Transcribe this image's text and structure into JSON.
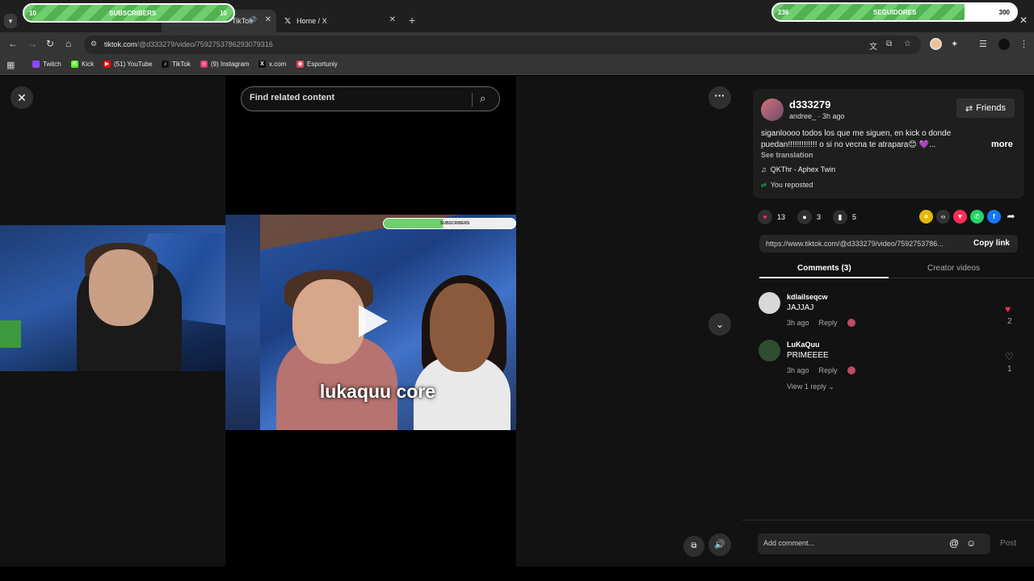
{
  "browser": {
    "tabs": [
      {
        "label": "TikTok",
        "active": true
      },
      {
        "label": "Home / X",
        "active": false
      }
    ],
    "url_host": "tiktok.com",
    "url_path": "/@d333279/video/7592753786293079316",
    "bookmarks": [
      {
        "label": "Twitch",
        "color": "#9146ff"
      },
      {
        "label": "Kick",
        "color": "#53fc18"
      },
      {
        "label": "(51) YouTube",
        "color": "#ff0000"
      },
      {
        "label": "TikTok",
        "color": "#111111"
      },
      {
        "label": "(9) Instagram",
        "color": "#e1306c"
      },
      {
        "label": "x.com",
        "color": "#111111"
      },
      {
        "label": "Esportuniy",
        "color": "#e0405a"
      }
    ]
  },
  "overlays": {
    "subscribers": {
      "left": "10",
      "label": "SUBSCRIBERS",
      "right": "10"
    },
    "seguidores": {
      "left": "236",
      "label": "SEGUIDORES",
      "right": "300",
      "progress": 0.787
    }
  },
  "player": {
    "search_placeholder": "Find related content",
    "caption": "lukaquu core",
    "mini_bar_label": "SUBSCRIBERS"
  },
  "post": {
    "username": "d333279",
    "sub": "andree_ · 3h ago",
    "friends_label": "Friends",
    "description": "siganloooo todos los que me siguen, en kick o donde puedan!!!!!!!!!!!!! o si no vecna te atrapara😊 💜...",
    "more_label": "more",
    "see_translation": "See translation",
    "music": "QKThr - Aphex Twin",
    "reposted": "You reposted",
    "likes": "13",
    "comments_count": "3",
    "saves": "5",
    "link": "https://www.tiktok.com/@d333279/video/7592753786...",
    "copy_label": "Copy link",
    "tab_comments": "Comments (3)",
    "tab_creator": "Creator videos"
  },
  "comments": [
    {
      "name": "kdlailseqcw",
      "text": "JAJJAJ",
      "time": "3h ago",
      "reply": "Reply",
      "likes": "2",
      "liked": true
    },
    {
      "name": "LuKaQuu",
      "text": "PRIMEEEE",
      "time": "3h ago",
      "reply": "Reply",
      "likes": "1",
      "liked": false
    }
  ],
  "view_reply": "View 1 reply",
  "composer": {
    "placeholder": "Add comment...",
    "post_label": "Post"
  },
  "colors": {
    "accent_red": "#fe2c55",
    "panel_bg": "#121212"
  }
}
